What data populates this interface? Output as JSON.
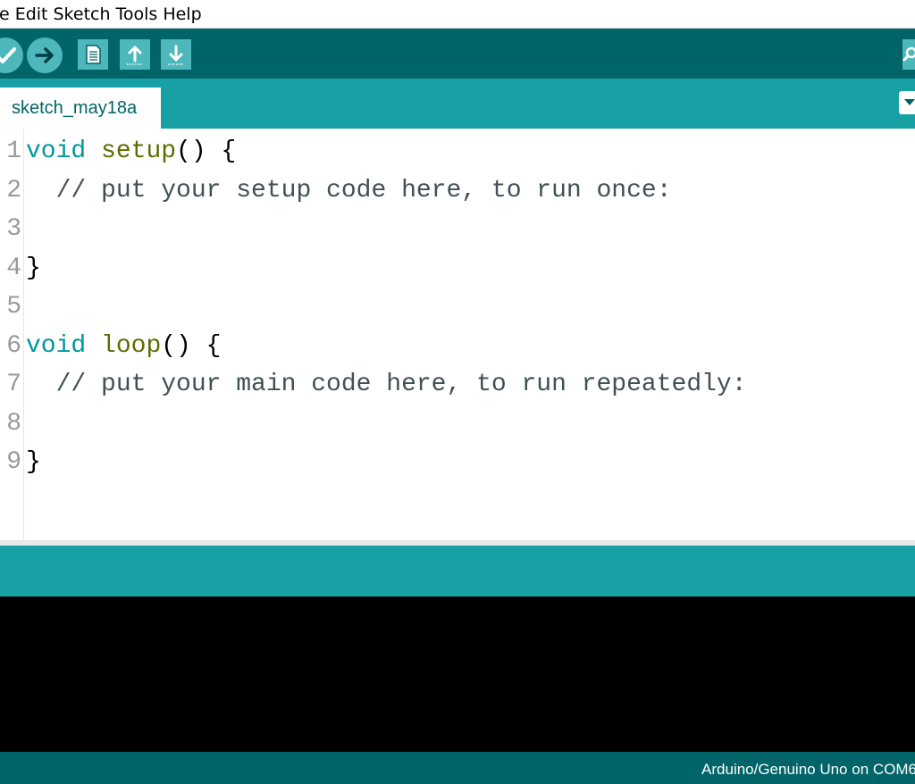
{
  "menubar": {
    "items": [
      "e",
      "Edit",
      "Sketch",
      "Tools",
      "Help"
    ]
  },
  "toolbar": {
    "buttons": [
      {
        "name": "verify",
        "icon": "check-icon"
      },
      {
        "name": "upload",
        "icon": "arrow-right-icon"
      },
      {
        "name": "new",
        "icon": "document-icon"
      },
      {
        "name": "open",
        "icon": "arrow-up-icon"
      },
      {
        "name": "save",
        "icon": "arrow-down-icon"
      },
      {
        "name": "serial-monitor",
        "icon": "magnifier-icon"
      }
    ],
    "colors": {
      "bar": "#006468",
      "button": "#4db7bb"
    }
  },
  "tabs": {
    "active": "sketch_may18a"
  },
  "editor": {
    "line_numbers": [
      "1",
      "2",
      "3",
      "4",
      "5",
      "6",
      "7",
      "8",
      "9"
    ],
    "lines": [
      {
        "kw": "void",
        "fn": "setup",
        "rest": "() {"
      },
      {
        "indent": "  ",
        "comment": "// put your setup code here, to run once:"
      },
      {},
      {
        "rest": "}"
      },
      {},
      {
        "kw": "void",
        "fn": "loop",
        "rest": "() {"
      },
      {
        "indent": "  ",
        "comment": "// put your main code here, to run repeatedly:"
      },
      {},
      {
        "rest": "}"
      }
    ]
  },
  "status": {
    "board": "Arduino/Genuino Uno on COM6"
  },
  "colors": {
    "tabbar": "#17a1a5",
    "keyword": "#00979c",
    "function": "#5e6d03",
    "console": "#000000"
  }
}
